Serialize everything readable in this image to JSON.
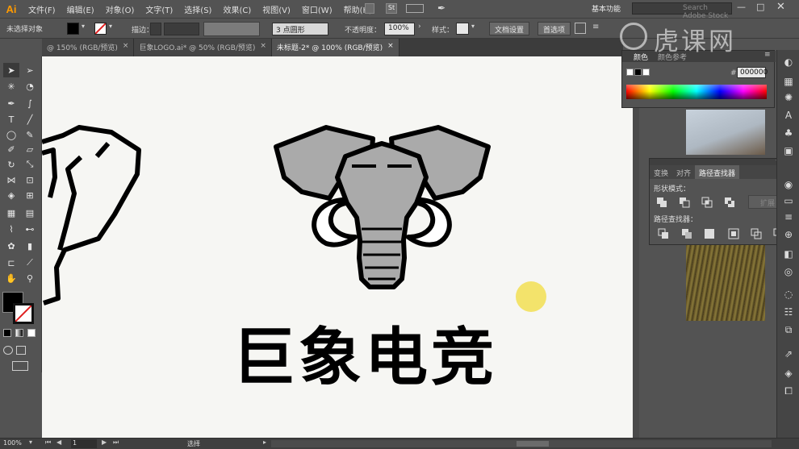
{
  "app": {
    "logo": "Ai",
    "workspace": "基本功能",
    "search_placeholder": "Search Adobe Stock"
  },
  "menus": [
    "文件(F)",
    "编辑(E)",
    "对象(O)",
    "文字(T)",
    "选择(S)",
    "效果(C)",
    "视图(V)",
    "窗口(W)",
    "帮助(H)"
  ],
  "control": {
    "selection_status": "未选择对象",
    "stroke_label": "描边：",
    "brush_value": "3 点圆形",
    "opacity_label": "不透明度：",
    "opacity_value": "100%",
    "style_label": "样式：",
    "doc_setup": "文档设置",
    "preferences": "首选项"
  },
  "tabs": [
    {
      "label": "@ 150% (RGB/预览)",
      "active": false
    },
    {
      "label": "巨象LOGO.ai* @ 50% (RGB/预览)",
      "active": false
    },
    {
      "label": "未标题-2* @ 100% (RGB/预览)",
      "active": true
    }
  ],
  "color_panel": {
    "tabs": [
      "颜色",
      "颜色参考"
    ],
    "hex_prefix": "#",
    "hex_value": "000000"
  },
  "pathfinder": {
    "tabs": [
      "变换",
      "对齐",
      "路径查找器"
    ],
    "shape_modes_label": "形状模式：",
    "pathfinders_label": "路径查找器：",
    "expand_button": "扩展"
  },
  "canvas": {
    "logo_text": "巨象电竞",
    "highlight_color": "#f3e36b"
  },
  "status": {
    "zoom": "100%",
    "page": "1",
    "tool": "选择"
  },
  "watermark": "虎课网",
  "colors": {
    "ui_bg": "#535353",
    "canvas": "#f6f6f3",
    "elephant_gray": "#aaaaaa",
    "accent": "#ff9a00"
  }
}
